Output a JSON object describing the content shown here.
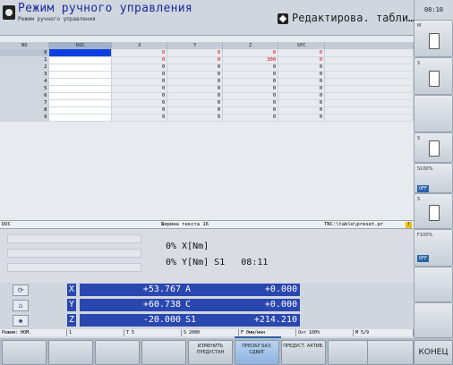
{
  "header": {
    "title": "Режим ручного управления",
    "subtitle": "Режим ручного управления",
    "edit_mode": "Редактирова. табли…",
    "clock": "08:10"
  },
  "table": {
    "columns": [
      "NO",
      "DOC",
      "X",
      "Y",
      "Z",
      "SPC"
    ],
    "rows": [
      {
        "no": "0",
        "x": "0",
        "y": "0",
        "z": "0",
        "spc": "0",
        "red": true
      },
      {
        "no": "1",
        "x": "0",
        "y": "0",
        "z": "300",
        "spc": "0",
        "red": true
      },
      {
        "no": "2",
        "x": "0",
        "y": "0",
        "z": "0",
        "spc": "0"
      },
      {
        "no": "3",
        "x": "0",
        "y": "0",
        "z": "0",
        "spc": "0"
      },
      {
        "no": "4",
        "x": "0",
        "y": "0",
        "z": "0",
        "spc": "0"
      },
      {
        "no": "5",
        "x": "0",
        "y": "0",
        "z": "0",
        "spc": "0"
      },
      {
        "no": "6",
        "x": "0",
        "y": "0",
        "z": "0",
        "spc": "0"
      },
      {
        "no": "7",
        "x": "0",
        "y": "0",
        "z": "0",
        "spc": "0"
      },
      {
        "no": "8",
        "x": "0",
        "y": "0",
        "z": "0",
        "spc": "0"
      },
      {
        "no": "9",
        "x": "0",
        "y": "0",
        "z": "0",
        "spc": "0"
      }
    ]
  },
  "status": {
    "field": "DOC",
    "text_width": "Ширина текста 16",
    "path": "TNC:\\table\\preset.pr",
    "warn": "!"
  },
  "info": {
    "line1": "0% X[Nm]",
    "line2": "0% Y[Nm] S1   08:11"
  },
  "axes": [
    {
      "name": "X",
      "value": "+53.767",
      "name2": "A",
      "value2": "+0.000"
    },
    {
      "name": "Y",
      "value": "+60.738",
      "name2": "C",
      "value2": "+0.000"
    },
    {
      "name": "Z",
      "value": "-20.000",
      "name2": "S1",
      "value2": "+214.210"
    }
  ],
  "modebar": {
    "mode": "Режим: НОМ.",
    "tool": "1",
    "t": "T 5",
    "s": "S 2000",
    "f": "F 0мм/мин",
    "ovr": "Ovr 100%",
    "m": "M 5/9"
  },
  "softkeys": {
    "sk5": "ИЗМЕНИТЬ ПРЕДУСТАН",
    "sk6": "ПРЕОБР БАЗ. СДВИГ",
    "sk7": "ПРЕДУСТ. АКТИВ.",
    "end": "КОНЕЦ"
  },
  "right_panel": {
    "b1": "M",
    "b2": "S",
    "b4": "S",
    "b5": "S100%",
    "b5_off": "OFF",
    "b6": "S",
    "b7": "F100%",
    "b7_off": "OFF"
  },
  "colors": {
    "accent": "#2a47b0",
    "title": "#1d2b9f",
    "active_cell": "#0d3fe0"
  }
}
